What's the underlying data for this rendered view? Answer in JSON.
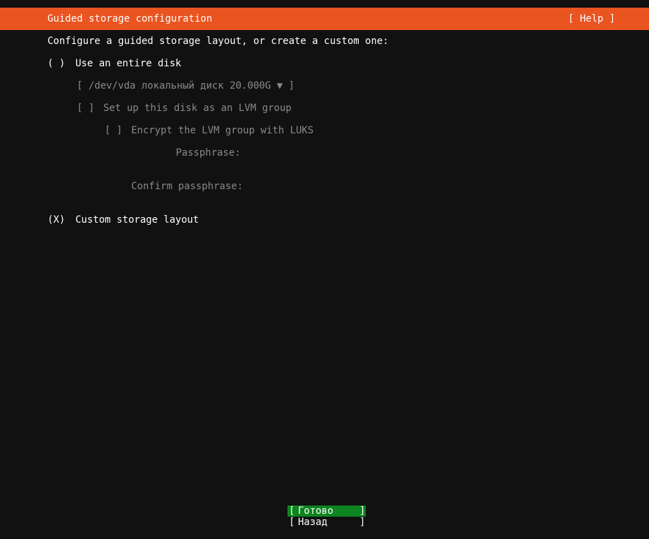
{
  "header": {
    "title": "Guided storage configuration",
    "help_label": "[ Help ]",
    "color": "#e95420"
  },
  "instructions": "Configure a guided storage layout, or create a custom one:",
  "entire_disk": {
    "marker": "( )",
    "label": "Use an entire disk",
    "disk_select": {
      "open": "[",
      "value": "/dev/vda локальный диск 20.000G",
      "arrow": "▼",
      "close": "]"
    },
    "lvm": {
      "marker": "[ ]",
      "label": "Set up this disk as an LVM group"
    },
    "encrypt": {
      "marker": "[ ]",
      "label": "Encrypt the LVM group with LUKS"
    },
    "passphrase_label": "Passphrase:",
    "confirm_passphrase_label": "Confirm passphrase:"
  },
  "custom": {
    "marker": "(X)",
    "label": "Custom storage layout"
  },
  "buttons": {
    "done": {
      "open": "[",
      "label": "Готово",
      "close": "]",
      "color": "#0e8420"
    },
    "back": {
      "open": "[",
      "label": "Назад",
      "close": "]"
    }
  }
}
